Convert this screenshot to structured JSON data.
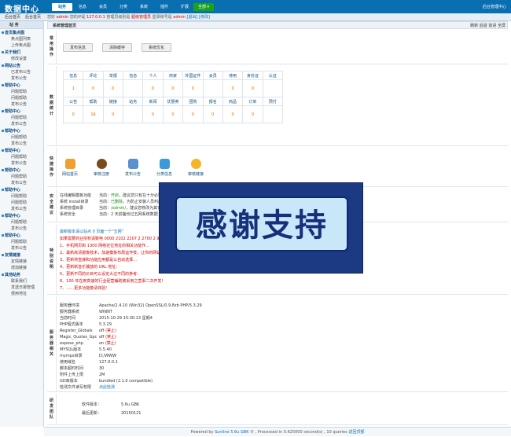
{
  "header": {
    "logo": "数据中心",
    "nav": [
      "站务",
      "信息",
      "会员",
      "分类",
      "系统",
      "插件",
      "扩展"
    ],
    "nav_active": 0,
    "select": "全部",
    "right_text": "后台管理中心"
  },
  "subbar": {
    "items": [
      "后台首页",
      "后台首页"
    ],
    "admin_label": "您好",
    "admin_name": "admin",
    "ip_label": "您的IP是",
    "ip": "127.0.0.1",
    "group_label": "管理员级别是",
    "group": "超级管理员",
    "login_label": "登录账号是",
    "login_name": "admin",
    "logout": "[退出]",
    "edit": "[修改]"
  },
  "sidebar": {
    "title": "站 务",
    "groups": [
      {
        "title": "首页集点图",
        "items": [
          "焦点图列表",
          "上传焦点图"
        ]
      },
      {
        "title": "关于我们",
        "items": [
          "修改设置"
        ]
      },
      {
        "title": "网站公告",
        "items": [
          "已发布公告",
          "发布公告"
        ]
      },
      {
        "title": "帮助中心",
        "items": [
          "问题帮助",
          "问题帮助",
          "发布公告"
        ]
      },
      {
        "title": "帮助中心",
        "items": [
          "问题帮助",
          "发布公告"
        ]
      },
      {
        "title": "帮助中心",
        "items": [
          "问题帮助",
          "发布公告"
        ]
      },
      {
        "title": "帮助中心",
        "items": [
          "问题帮助",
          "发布公告"
        ]
      },
      {
        "title": "帮助中心",
        "items": [
          "问题帮助",
          "发布公告"
        ]
      },
      {
        "title": "帮助中心",
        "items": [
          "问题帮助",
          "问题帮助",
          "发布公告"
        ]
      },
      {
        "title": "帮助中心",
        "items": [
          "问题帮助",
          "发布公告"
        ]
      },
      {
        "title": "帮助中心",
        "items": [
          "问题帮助",
          "发布公告"
        ]
      },
      {
        "title": "友情链接",
        "items": [
          "友情链接",
          "增加链接"
        ]
      },
      {
        "title": "其他站务",
        "items": [
          "联系我们",
          "发送日报管理",
          "便用地址"
        ]
      }
    ]
  },
  "main": {
    "title": "系统管理首页",
    "tools": [
      "刷新",
      "后退",
      "前进",
      "全屏"
    ],
    "ops": {
      "label": "常用操作",
      "buttons": [
        "发布信息",
        "清除缓存",
        "系统优化"
      ]
    },
    "stats": {
      "label": "数据统计",
      "row1_labels": [
        "信息",
        "评论",
        "举报",
        "信息",
        "个人",
        "商家",
        "外国证件",
        "会员",
        "待用",
        "身份证",
        "认证"
      ],
      "row1_values": [
        "1",
        "0",
        "0",
        "",
        "0",
        "0",
        "0",
        "",
        "0",
        "0",
        ""
      ],
      "row2_labels": [
        "公告",
        "帮助",
        "链接",
        "站务",
        "新闻",
        "优惠券",
        "团购",
        "报名",
        "商品",
        "订单",
        "预付"
      ],
      "row2_values": [
        "0",
        "16",
        "0",
        "",
        "0",
        "0",
        "0",
        "0",
        "0",
        "0",
        ""
      ]
    },
    "quick": {
      "label": "快捷操作",
      "items": [
        "网站首页",
        "审核注册",
        "发布公告",
        "分类信息",
        "审核链接"
      ]
    },
    "security": {
      "label": "安全建议",
      "rows": [
        {
          "k": "在线编辑模板功能",
          "v1": "当前：",
          "v2": "开启",
          "v3": "，建议您只有在十分必要的时候才开启它，请修改 /data/config.inc.php 关闭此功能"
        },
        {
          "k": "系统 install目录",
          "v1": "当前：",
          "v2": "已删除",
          "v3": "，为防止安装人员利用，建议您使后请删除，删除该目录"
        },
        {
          "k": "系统管理目录",
          "v1": "当前：",
          "v2": "/admin/",
          "v3": "，建议您修改为其它名称，修改后需要手动修改配置文件"
        },
        {
          "k": "系统安全",
          "v1": "当前：",
          "v2": "",
          "v3": "2 天前备份过五网系统数据"
        }
      ]
    },
    "notes": {
      "label": "特别说明",
      "lines": [
        "最新版本请以站点 0 页面一个\"五网\"",
        "如果需要商业授权请致电 0000 2102 2207 2 2700 2 9420 数据中心...",
        "1、手机网页和 1300 网络定位地址的相关功能作...",
        "2、最新高清摄像技术，加速模板布局运作技，让你的网站飞...",
        "3、更新将直接和功能应用都是以自动选择...",
        "4、更新新音乐播放的 URL 地址：",
        "5、更新不同的价目可以设定大过不同的参考：",
        "6、100 年在用高速的行业经营辅助被采用之营事二次开发！",
        "7、……更多功能敬请体验!"
      ]
    },
    "server": {
      "label": "服务器相关",
      "rows": [
        {
          "k": "服务器环境",
          "v": "Apache/2.4.10 (Win32) OpenSSL/0.9.8zb PHP/5.3.29"
        },
        {
          "k": "服务器系统",
          "v": "WINNT"
        },
        {
          "k": "当前时间",
          "v": "2015-10-29 15:30:13 星期4"
        },
        {
          "k": "PHP程式版本",
          "v": "5.3.29"
        },
        {
          "k": "Register_Globals",
          "v": "off",
          "tag": "(禁止)"
        },
        {
          "k": "Magic_Quotes_Gpc",
          "v": "off",
          "tag": "(禁止)"
        },
        {
          "k": "expose_php",
          "v": "on",
          "tag": "(禁止)"
        },
        {
          "k": "MYSQL版本",
          "v": "5.5.40"
        },
        {
          "k": "mymps目录",
          "v": "D:/WWW"
        },
        {
          "k": "使用域名",
          "v": "127.0.0.1"
        },
        {
          "k": "脚本超时时间",
          "v": "30"
        },
        {
          "k": "附件上传上限",
          "v": "2M"
        },
        {
          "k": "GD库版本",
          "v": "bundled (2.1.0 compatible)"
        },
        {
          "k": "检测文件读写权限",
          "v": "点此检测"
        }
      ]
    },
    "team": {
      "label": "研发团队",
      "rows": [
        {
          "k": "软件版本：",
          "v": "5.6u GBK"
        },
        {
          "k": "最后更新：",
          "v": "20150121"
        }
      ]
    }
  },
  "banner": {
    "text": "感谢支持"
  },
  "footer": {
    "text": "Powered by",
    "brand": "Sunline 5.6u GBK",
    "info": "© , Processed in 0.625000 second(s) , 10 queries",
    "link": "返回顶部"
  }
}
